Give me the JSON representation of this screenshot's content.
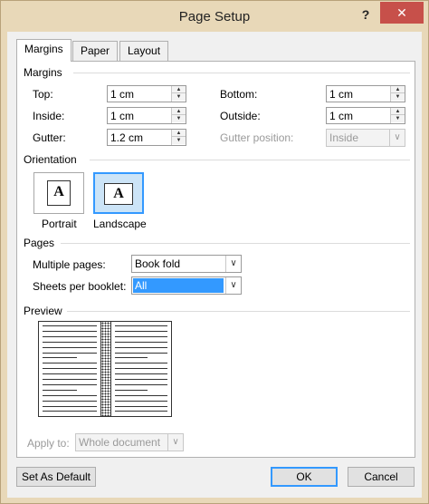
{
  "window": {
    "title": "Page Setup",
    "help": "?",
    "close": "✕"
  },
  "tabs": [
    "Margins",
    "Paper",
    "Layout"
  ],
  "margins": {
    "group": "Margins",
    "top_label": "Top:",
    "top_value": "1 cm",
    "bottom_label": "Bottom:",
    "bottom_value": "1 cm",
    "inside_label": "Inside:",
    "inside_value": "1 cm",
    "outside_label": "Outside:",
    "outside_value": "1 cm",
    "gutter_label": "Gutter:",
    "gutter_value": "1.2 cm",
    "gutter_position_label": "Gutter position:",
    "gutter_position_value": "Inside"
  },
  "orientation": {
    "group": "Orientation",
    "portrait": "Portrait",
    "landscape": "Landscape",
    "glyph": "A",
    "selected": "landscape"
  },
  "pages": {
    "group": "Pages",
    "multiple_label": "Multiple pages:",
    "multiple_value": "Book fold",
    "sheets_label": "Sheets per booklet:",
    "sheets_value": "All"
  },
  "preview": {
    "group": "Preview"
  },
  "apply": {
    "label": "Apply to:",
    "value": "Whole document"
  },
  "buttons": {
    "set_default": "Set As Default",
    "ok": "OK",
    "cancel": "Cancel"
  },
  "colors": {
    "accent": "#3399ff",
    "frame": "#e8d8b8",
    "close": "#c7504a"
  }
}
